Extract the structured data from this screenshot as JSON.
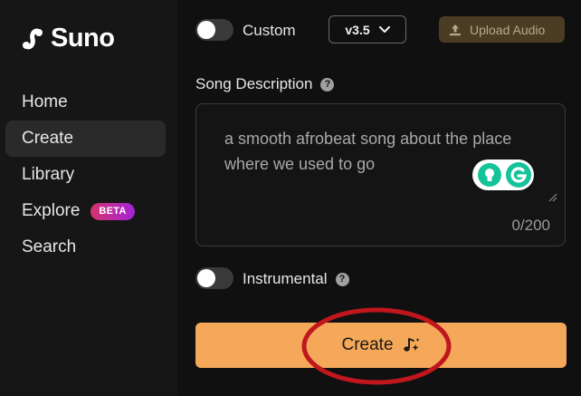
{
  "brand": {
    "name": "Suno"
  },
  "sidebar": {
    "items": [
      {
        "label": "Home"
      },
      {
        "label": "Create",
        "active": true
      },
      {
        "label": "Library"
      },
      {
        "label": "Explore",
        "badge": "BETA"
      },
      {
        "label": "Search"
      }
    ]
  },
  "toolbar": {
    "custom_label": "Custom",
    "custom_enabled": false,
    "version_label": "v3.5",
    "upload_label": "Upload Audio"
  },
  "song_description": {
    "title": "Song Description",
    "value": "a smooth afrobeat song about the place where we used to go",
    "counter": "0/200"
  },
  "instrumental": {
    "label": "Instrumental",
    "enabled": false
  },
  "create_button": {
    "label": "Create"
  },
  "colors": {
    "accent": "#f5a859",
    "upload_bg": "#4a3d24",
    "badge_gradient_start": "#d6336c",
    "badge_gradient_end": "#a324d8",
    "annotation": "#c0161d",
    "grammarly_green": "#15c39a"
  },
  "icons": {
    "logo": "suno-logo-icon",
    "version_dropdown": "chevron-down-icon",
    "upload": "upload-icon",
    "help": "question-mark-icon",
    "create": "music-sparkle-icon",
    "grammarly": "grammarly-icon"
  }
}
